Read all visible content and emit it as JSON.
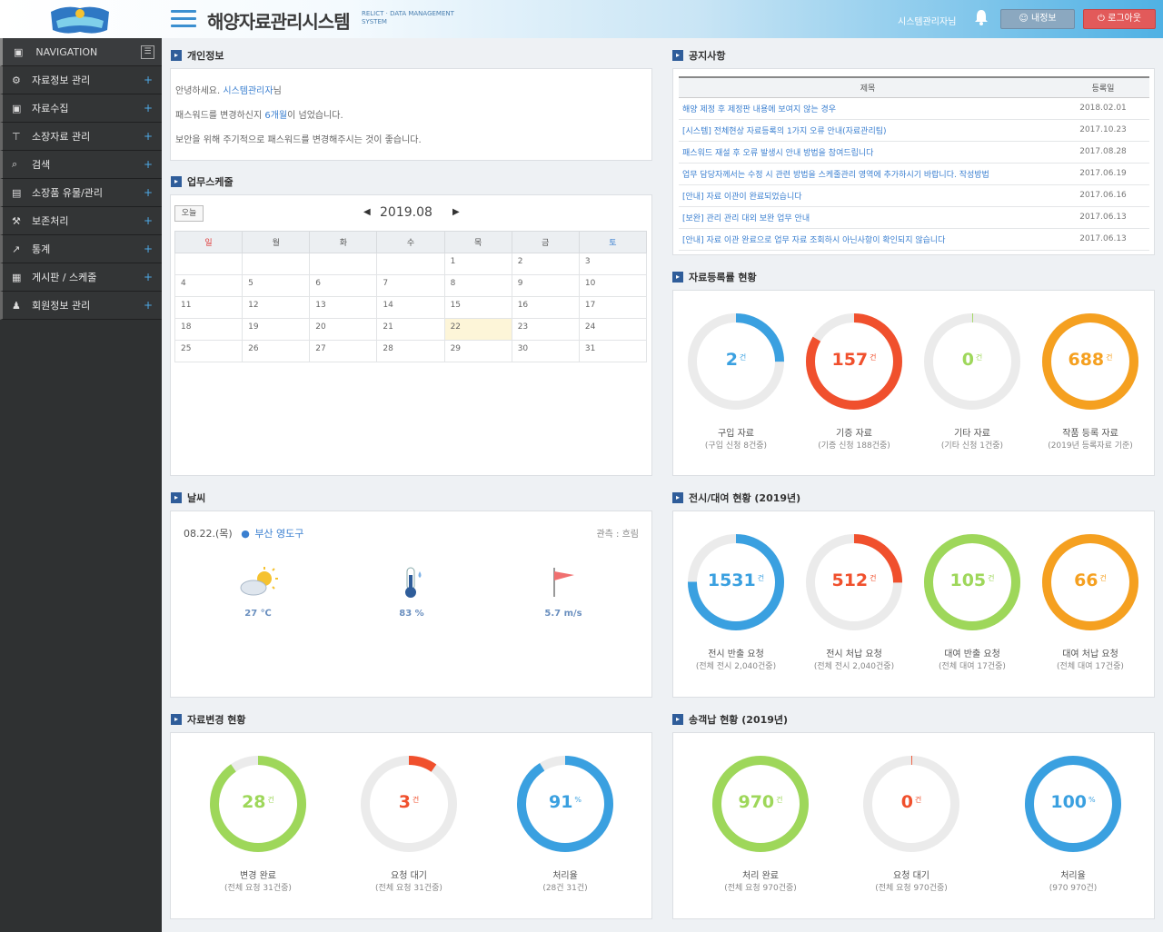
{
  "header": {
    "title": "해양자료관리시스템",
    "subtitle": "RELICT · DATA MANAGEMENT SYSTEM",
    "admin_label": "시스템관리자님",
    "my_info_label": "내정보",
    "logout_label": "로그아웃"
  },
  "sidebar": {
    "heading": "NAVIGATION",
    "items": [
      {
        "label": "자료정보 관리",
        "icon": "gear-icon"
      },
      {
        "label": "자료수집",
        "icon": "lock-icon"
      },
      {
        "label": "소장자료 관리",
        "icon": "pin-icon"
      },
      {
        "label": "검색",
        "icon": "search-icon"
      },
      {
        "label": "소장품 유물/관리",
        "icon": "box-icon"
      },
      {
        "label": "보존처리",
        "icon": "wrench-icon"
      },
      {
        "label": "통계",
        "icon": "chart-icon"
      },
      {
        "label": "게시판 / 스케줄",
        "icon": "calendar-icon"
      },
      {
        "label": "회원정보 관리",
        "icon": "user-icon"
      }
    ]
  },
  "notice": {
    "title": "개인정보",
    "line1_pre": "안녕하세요. ",
    "line1_name": "시스템관리자",
    "line1_post": "님",
    "line2_pre": "패스워드를 변경하신지 ",
    "line2_hl": "6개월",
    "line2_post": "이 넘었습니다.",
    "line3": "보안을 위해 주기적으로 패스워드를 변경해주시는 것이 좋습니다."
  },
  "schedule": {
    "title": "업무스케줄",
    "today_label": "오늘",
    "month": "2019.08",
    "weekdays": [
      "일",
      "월",
      "화",
      "수",
      "목",
      "금",
      "토"
    ],
    "weeks": [
      [
        "",
        "",
        "",
        "",
        "1",
        "2",
        "3"
      ],
      [
        "4",
        "5",
        "6",
        "7",
        "8",
        "9",
        "10"
      ],
      [
        "11",
        "12",
        "13",
        "14",
        "15",
        "16",
        "17"
      ],
      [
        "18",
        "19",
        "20",
        "21",
        "22",
        "23",
        "24"
      ],
      [
        "25",
        "26",
        "27",
        "28",
        "29",
        "30",
        "31"
      ]
    ],
    "today": "22"
  },
  "board": {
    "title": "공지사항",
    "col_title": "제목",
    "col_date": "등록일",
    "rows": [
      {
        "title": "해양 제정 후 제정판 내용에 보여지 않는 경우",
        "date": "2018.02.01"
      },
      {
        "title": "[시스템] 전체현상 자료등록의 1가지 오류 안내(자료관리팀)",
        "date": "2017.10.23"
      },
      {
        "title": "패스워드 재설 후 오류 발생시 안내 방법을 참여드립니다",
        "date": "2017.08.28"
      },
      {
        "title": "업무 담당자께서는 수정 시 관련 방법을 스케줄관리 영역에 추가하시기 바랍니다. 작성방법",
        "date": "2017.06.19"
      },
      {
        "title": "[안내] 자료 이관이 완료되었습니다",
        "date": "2017.06.16"
      },
      {
        "title": "[보완] 관리 관리 대외 보완 업무 안내",
        "date": "2017.06.13"
      },
      {
        "title": "[안내] 자료 이관 완료으로 업무 자료 조회하시 아닌사항이 확인되지 않습니다",
        "date": "2017.06.13"
      }
    ]
  },
  "registration": {
    "title": "자료등록률 현황",
    "items": [
      {
        "value": "2",
        "unit": "건",
        "label": "구입 자료",
        "sub": "(구입 신청 8건중)",
        "color": "#3aa0e0"
      },
      {
        "value": "157",
        "unit": "건",
        "label": "기증 자료",
        "sub": "(기증 신청 188건중)",
        "color": "#f0502d"
      },
      {
        "value": "0",
        "unit": "건",
        "label": "기타 자료",
        "sub": "(기타 신청 1건중)",
        "color": "#9ed75a"
      },
      {
        "value": "688",
        "unit": "건",
        "label": "작품 등록 자료",
        "sub": "(2019년 등록자료 기준)",
        "color": "#f5a020"
      }
    ]
  },
  "weather": {
    "title": "날씨",
    "date": "08.22.(목)",
    "location": "부산 영도구",
    "status": "관측 : 흐림",
    "temp": "27 ℃",
    "humidity": "83 %",
    "wind": "5.7 m/s"
  },
  "exhibition": {
    "title": "전시/대여 현황 (2019년)",
    "items": [
      {
        "value": "1531",
        "unit": "건",
        "label": "전시 반출 요청",
        "sub": "(전체 전시 2,040건중)",
        "color": "#3aa0e0"
      },
      {
        "value": "512",
        "unit": "건",
        "label": "전시 처납 요청",
        "sub": "(전체 전시 2,040건중)",
        "color": "#f0502d"
      },
      {
        "value": "105",
        "unit": "건",
        "label": "대여 반출 요청",
        "sub": "(전체 대여 17건중)",
        "color": "#9ed75a"
      },
      {
        "value": "66",
        "unit": "건",
        "label": "대여 처납 요청",
        "sub": "(전체 대여 17건중)",
        "color": "#f5a020"
      }
    ]
  },
  "change": {
    "title": "자료변경 현황",
    "items": [
      {
        "value": "28",
        "unit": "건",
        "label": "변경 완료",
        "sub": "(전체 요청 31건중)",
        "color": "#9ed75a"
      },
      {
        "value": "3",
        "unit": "건",
        "label": "요청 대기",
        "sub": "(전체 요청 31건중)",
        "color": "#f0502d"
      },
      {
        "value": "91",
        "unit": "%",
        "label": "처리율",
        "sub": "(28건 31건)",
        "color": "#3aa0e0"
      }
    ]
  },
  "transport": {
    "title": "송객납 현황 (2019년)",
    "items": [
      {
        "value": "970",
        "unit": "건",
        "label": "처리 완료",
        "sub": "(전체 요청 970건중)",
        "color": "#9ed75a"
      },
      {
        "value": "0",
        "unit": "건",
        "label": "요청 대기",
        "sub": "(전체 요청 970건중)",
        "color": "#f0502d"
      },
      {
        "value": "100",
        "unit": "%",
        "label": "처리율",
        "sub": "(970 970건)",
        "color": "#3aa0e0"
      }
    ]
  }
}
